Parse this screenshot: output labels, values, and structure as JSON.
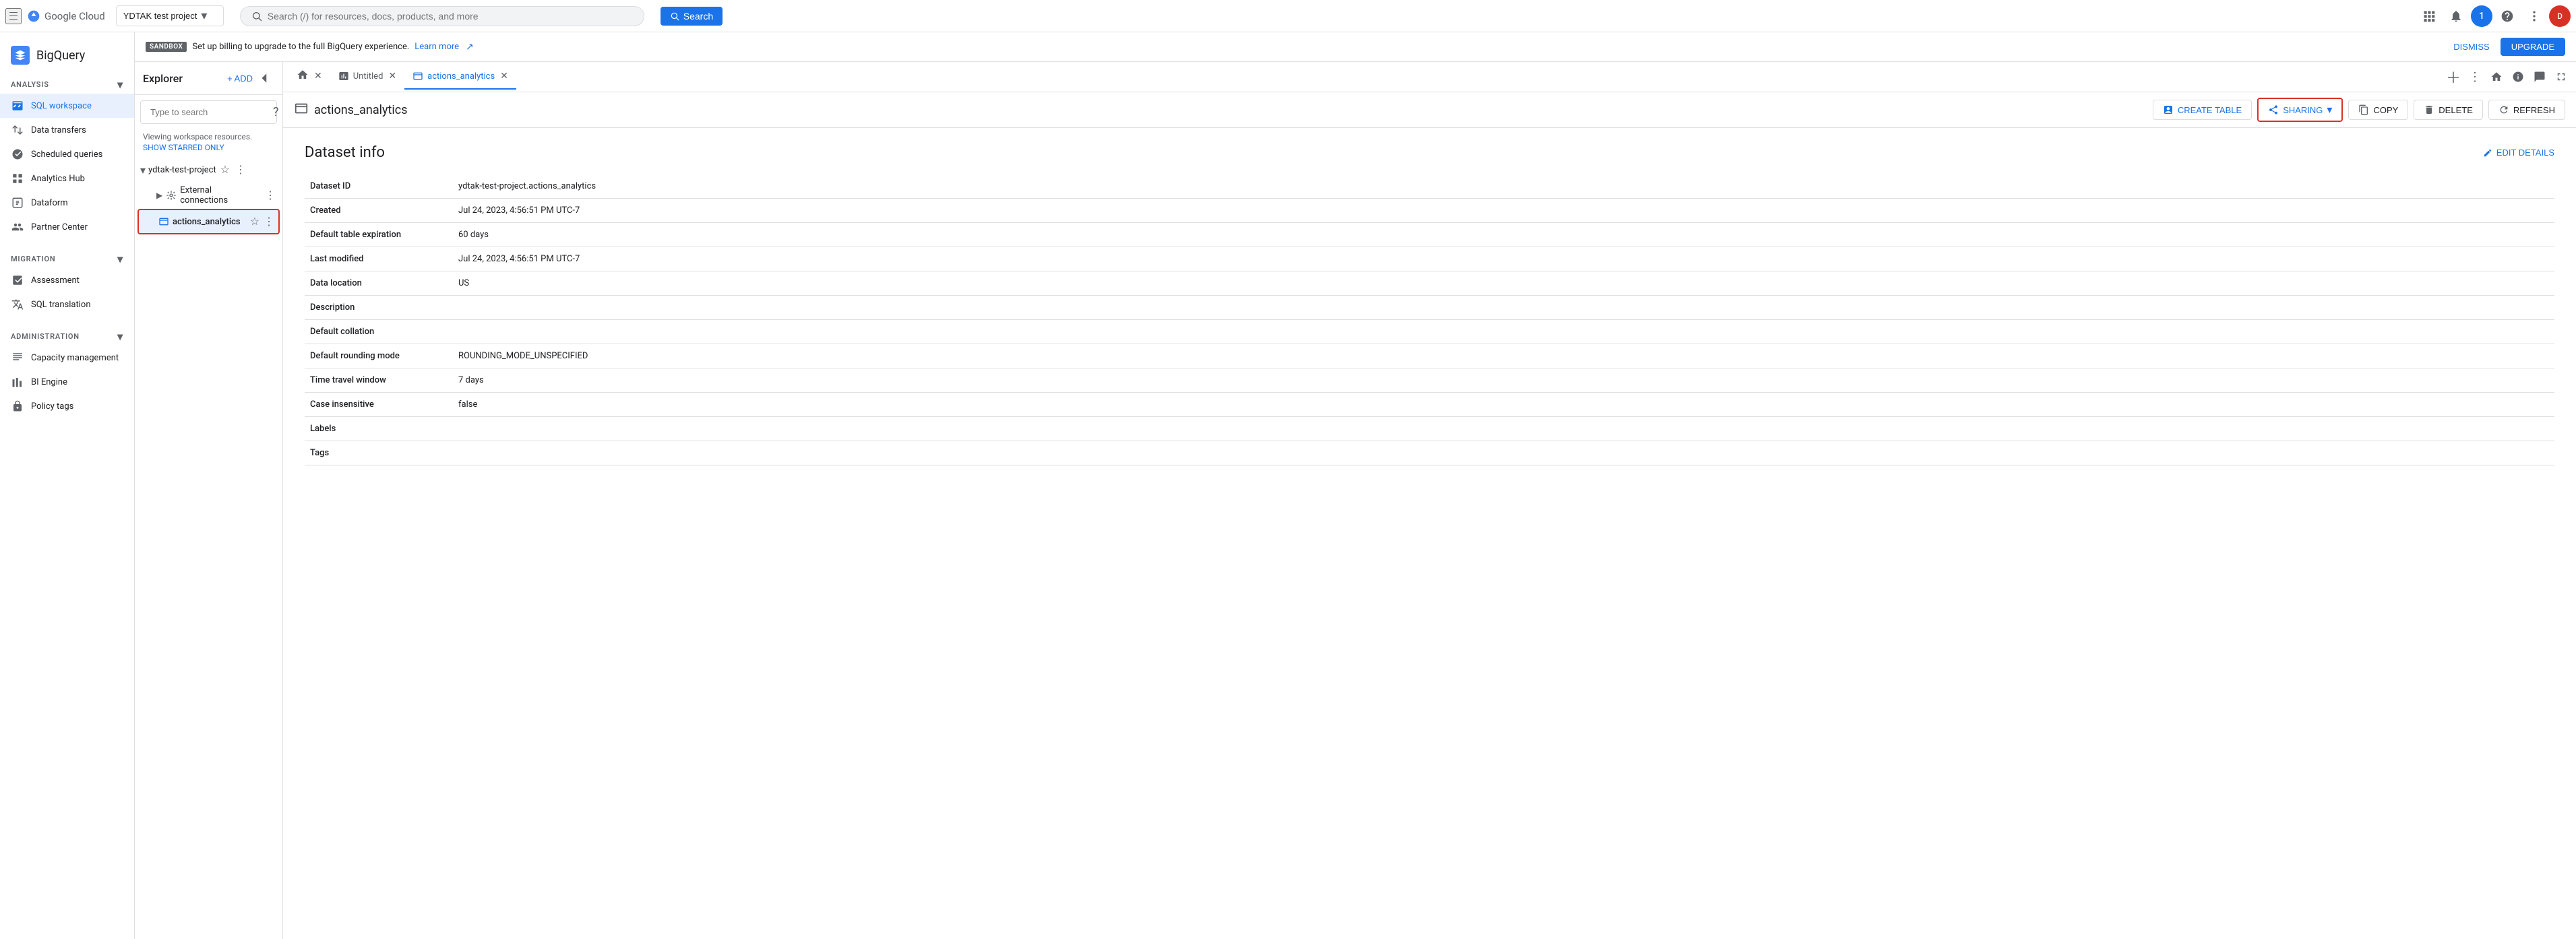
{
  "topNav": {
    "projectName": "YDTAK test project",
    "searchPlaceholder": "Search (/) for resources, docs, products, and more",
    "searchBtnLabel": "Search",
    "avatarInitial": "1"
  },
  "sidebar": {
    "appName": "BigQuery",
    "analysisLabel": "Analysis",
    "items": [
      {
        "id": "sql-workspace",
        "label": "SQL workspace",
        "active": true
      },
      {
        "id": "data-transfers",
        "label": "Data transfers",
        "active": false
      },
      {
        "id": "scheduled-queries",
        "label": "Scheduled queries",
        "active": false
      },
      {
        "id": "analytics-hub",
        "label": "Analytics Hub",
        "active": false
      },
      {
        "id": "dataform",
        "label": "Dataform",
        "active": false
      },
      {
        "id": "partner-center",
        "label": "Partner Center",
        "active": false
      }
    ],
    "migrationLabel": "Migration",
    "migrationItems": [
      {
        "id": "assessment",
        "label": "Assessment"
      },
      {
        "id": "sql-translation",
        "label": "SQL translation"
      }
    ],
    "administrationLabel": "Administration",
    "adminItems": [
      {
        "id": "capacity-management",
        "label": "Capacity management"
      },
      {
        "id": "bi-engine",
        "label": "BI Engine"
      },
      {
        "id": "policy-tags",
        "label": "Policy tags"
      }
    ]
  },
  "banner": {
    "badge": "SANDBOX",
    "message": "Set up billing to upgrade to the full BigQuery experience.",
    "learnMore": "Learn more",
    "dismiss": "DISMISS",
    "upgrade": "UPGRADE"
  },
  "explorer": {
    "title": "Explorer",
    "addBtn": "+ ADD",
    "searchPlaceholder": "Type to search",
    "workspaceText": "Viewing workspace resources.",
    "showStarredOnly": "SHOW STARRED ONLY",
    "projectName": "ydtak-test-project",
    "externalConnections": "External connections",
    "selectedDataset": "actions_analytics"
  },
  "tabs": [
    {
      "id": "home",
      "label": "",
      "isHome": true,
      "active": false
    },
    {
      "id": "untitled",
      "label": "Untitled",
      "active": false,
      "closeable": true
    },
    {
      "id": "actions-analytics",
      "label": "actions_analytics",
      "active": true,
      "closeable": true
    }
  ],
  "toolbar": {
    "datasetName": "actions_analytics",
    "createTableBtn": "CREATE TABLE",
    "sharingBtn": "SHARING",
    "copyBtn": "COPY",
    "deleteBtn": "DELETE",
    "refreshBtn": "REFRESH"
  },
  "datasetInfo": {
    "title": "Dataset info",
    "editDetails": "EDIT DETAILS",
    "fields": [
      {
        "label": "Dataset ID",
        "value": "ydtak-test-project.actions_analytics"
      },
      {
        "label": "Created",
        "value": "Jul 24, 2023, 4:56:51 PM UTC-7"
      },
      {
        "label": "Default table expiration",
        "value": "60 days"
      },
      {
        "label": "Last modified",
        "value": "Jul 24, 2023, 4:56:51 PM UTC-7"
      },
      {
        "label": "Data location",
        "value": "US"
      },
      {
        "label": "Description",
        "value": ""
      },
      {
        "label": "Default collation",
        "value": ""
      },
      {
        "label": "Default rounding mode",
        "value": "ROUNDING_MODE_UNSPECIFIED"
      },
      {
        "label": "Time travel window",
        "value": "7 days"
      },
      {
        "label": "Case insensitive",
        "value": "false"
      },
      {
        "label": "Labels",
        "value": ""
      },
      {
        "label": "Tags",
        "value": ""
      }
    ]
  }
}
